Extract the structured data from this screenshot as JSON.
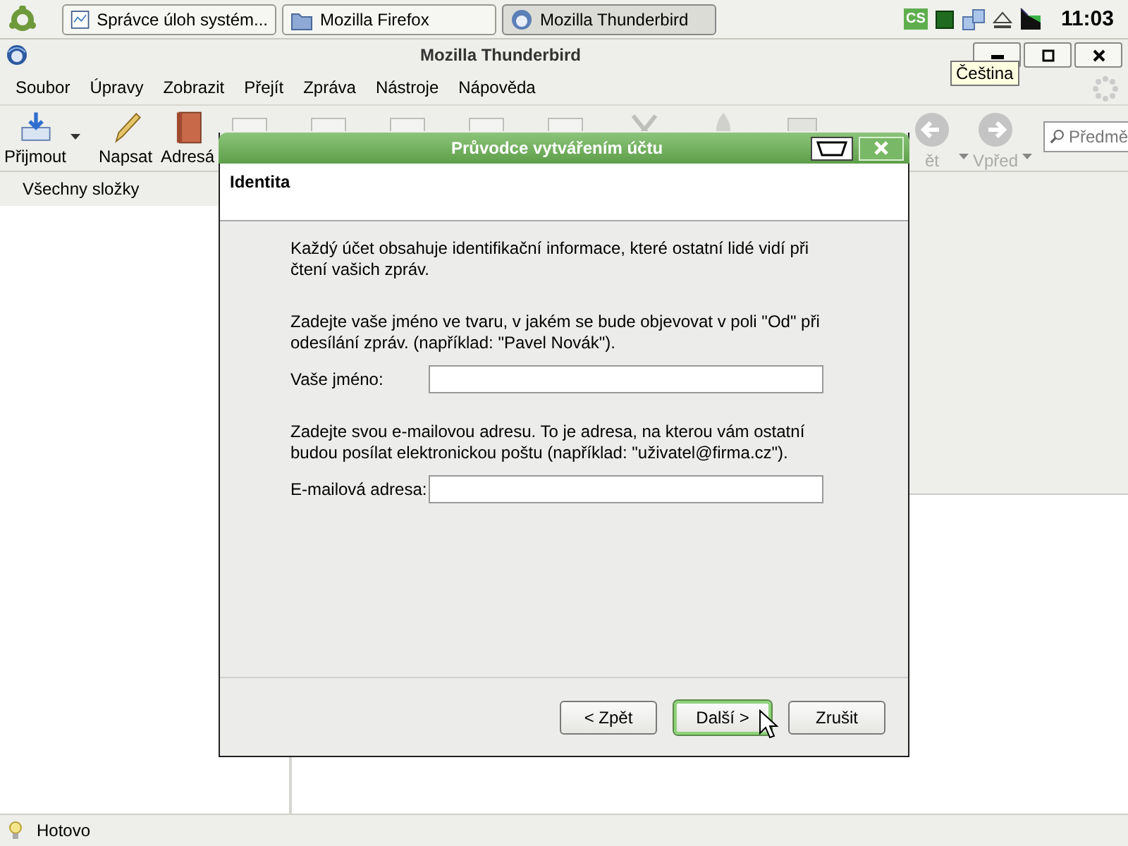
{
  "taskbar": {
    "tasks": [
      {
        "label": "Správce úloh systém...",
        "selected": false
      },
      {
        "label": "Mozilla Firefox",
        "selected": false
      },
      {
        "label": "Mozilla Thunderbird",
        "selected": true
      }
    ],
    "keyboard_indicator": "CS",
    "clock": "11:03"
  },
  "window": {
    "title": "Mozilla Thunderbird",
    "menu": [
      "Soubor",
      "Úpravy",
      "Zobrazit",
      "Přejít",
      "Zpráva",
      "Nástroje",
      "Nápověda"
    ],
    "toolbar": [
      {
        "label": "Přijmout",
        "kind": "split"
      },
      {
        "label": "Napsat",
        "kind": "button"
      },
      {
        "label": "Adresá",
        "kind": "button"
      }
    ],
    "nav": [
      {
        "label": "ět"
      },
      {
        "label": "Vpřed"
      }
    ],
    "search": {
      "placeholder": "Předmě"
    },
    "folder_pane": {
      "header": "Všechny složky"
    },
    "status_bar": "Hotovo"
  },
  "tooltip": "Čeština",
  "dialog": {
    "title": "Průvodce vytvářením účtu",
    "header": "Identita",
    "sections": [
      {
        "text": "Každý účet obsahuje identifikační informace, které ostatní lidé vidí při čtení vašich zpráv."
      },
      {
        "text": "Zadejte vaše jméno ve tvaru, v jakém se bude objevovat v poli \"Od\" při odesílání zpráv. (například: \"Pavel Novák\").",
        "field": {
          "label": "Vaše jméno:"
        }
      },
      {
        "text": "Zadejte svou e-mailovou adresu. To je adresa, na kterou vám ostatní budou posílat elektronickou poštu (například: \"uživatel@firma.cz\").",
        "field": {
          "label": "E-mailová adresa:"
        }
      }
    ],
    "buttons": [
      {
        "label": "< Zpět",
        "default": false
      },
      {
        "label": "Další >",
        "default": true
      },
      {
        "label": "Zrušit",
        "default": false
      }
    ]
  }
}
